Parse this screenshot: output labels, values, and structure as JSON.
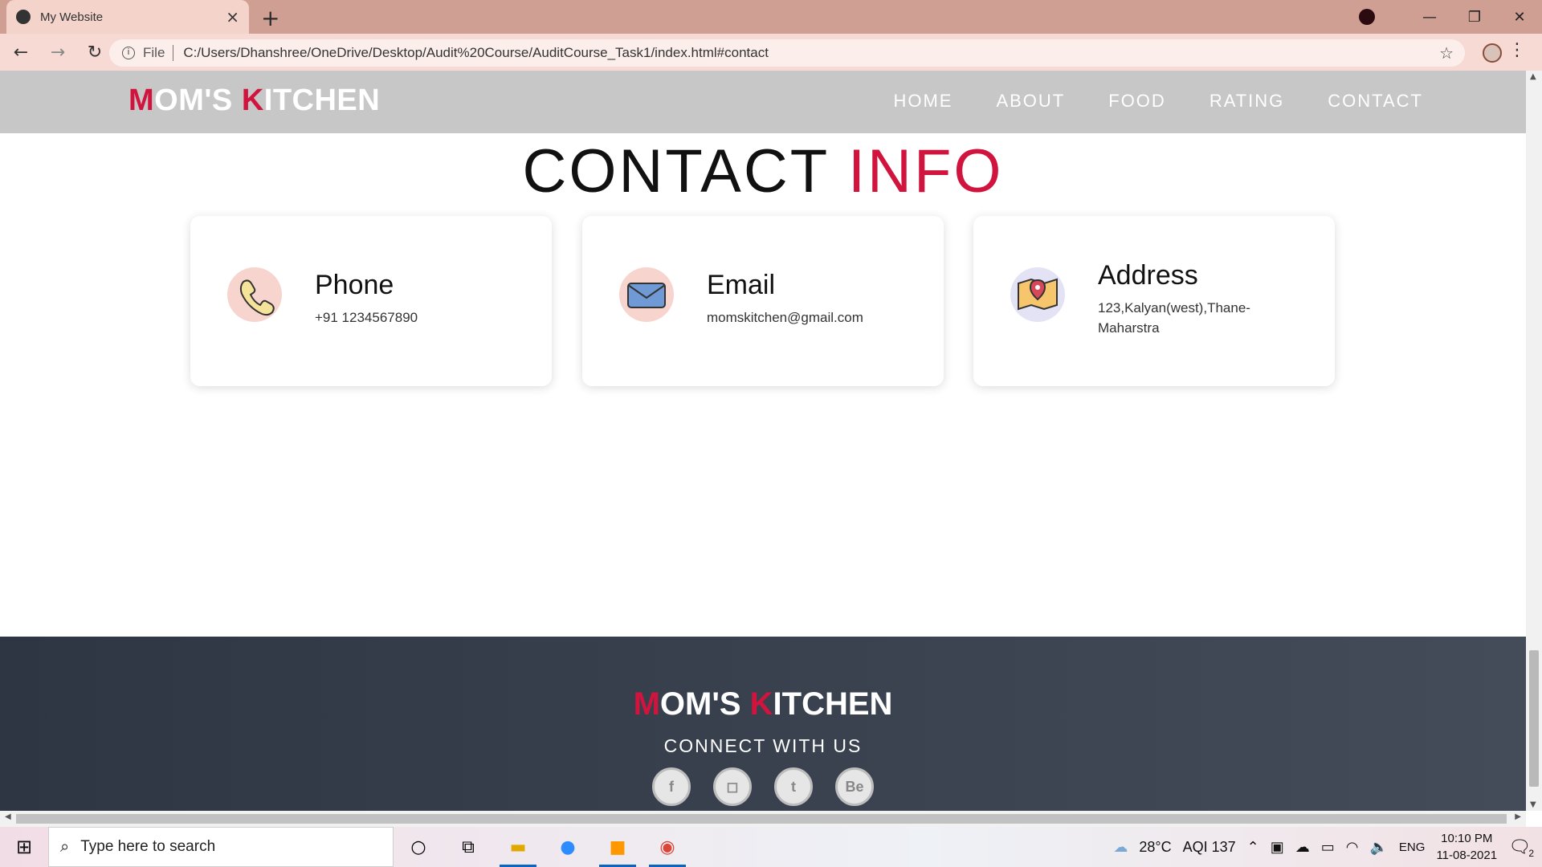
{
  "browser": {
    "tab_title": "My Website",
    "tab_close": "×",
    "new_tab": "+",
    "url_prefix": "File",
    "url": "C:/Users/Dhanshree/OneDrive/Desktop/Audit%20Course/AuditCourse_Task1/index.html#contact",
    "minimize": "—",
    "maximize": "❐",
    "close": "✕"
  },
  "site": {
    "logo_first_initial": "M",
    "logo_first_rest": "OM'S ",
    "logo_second_initial": "K",
    "logo_second_rest": "ITCHEN",
    "nav": [
      "HOME",
      "ABOUT",
      "FOOD",
      "RATING",
      "CONTACT"
    ],
    "accent_color": "#d0143e"
  },
  "contact": {
    "title_main": "CONTACT ",
    "title_accent": "INFO",
    "cards": [
      {
        "title": "Phone",
        "text": "+91 1234567890",
        "icon": "phone-icon"
      },
      {
        "title": "Email",
        "text": "momskitchen@gmail.com",
        "icon": "email-icon"
      },
      {
        "title": "Address",
        "text": "123,Kalyan(west),Thane-Maharstra",
        "icon": "map-icon"
      }
    ]
  },
  "footer": {
    "logo_first_initial": "M",
    "logo_first_rest": "OM'S ",
    "logo_second_initial": "K",
    "logo_second_rest": "ITCHEN",
    "connect": "CONNECT WITH US",
    "socials": [
      {
        "name": "facebook-icon",
        "glyph": "f"
      },
      {
        "name": "instagram-icon",
        "glyph": "◻"
      },
      {
        "name": "twitter-icon",
        "glyph": "t"
      },
      {
        "name": "behance-icon",
        "glyph": "Be"
      }
    ]
  },
  "taskbar": {
    "search_placeholder": "Type here to search",
    "weather": "28°C",
    "aqi": "AQI 137",
    "lang": "ENG",
    "time": "10:10 PM",
    "date": "11-08-2021",
    "notifications": "2"
  }
}
